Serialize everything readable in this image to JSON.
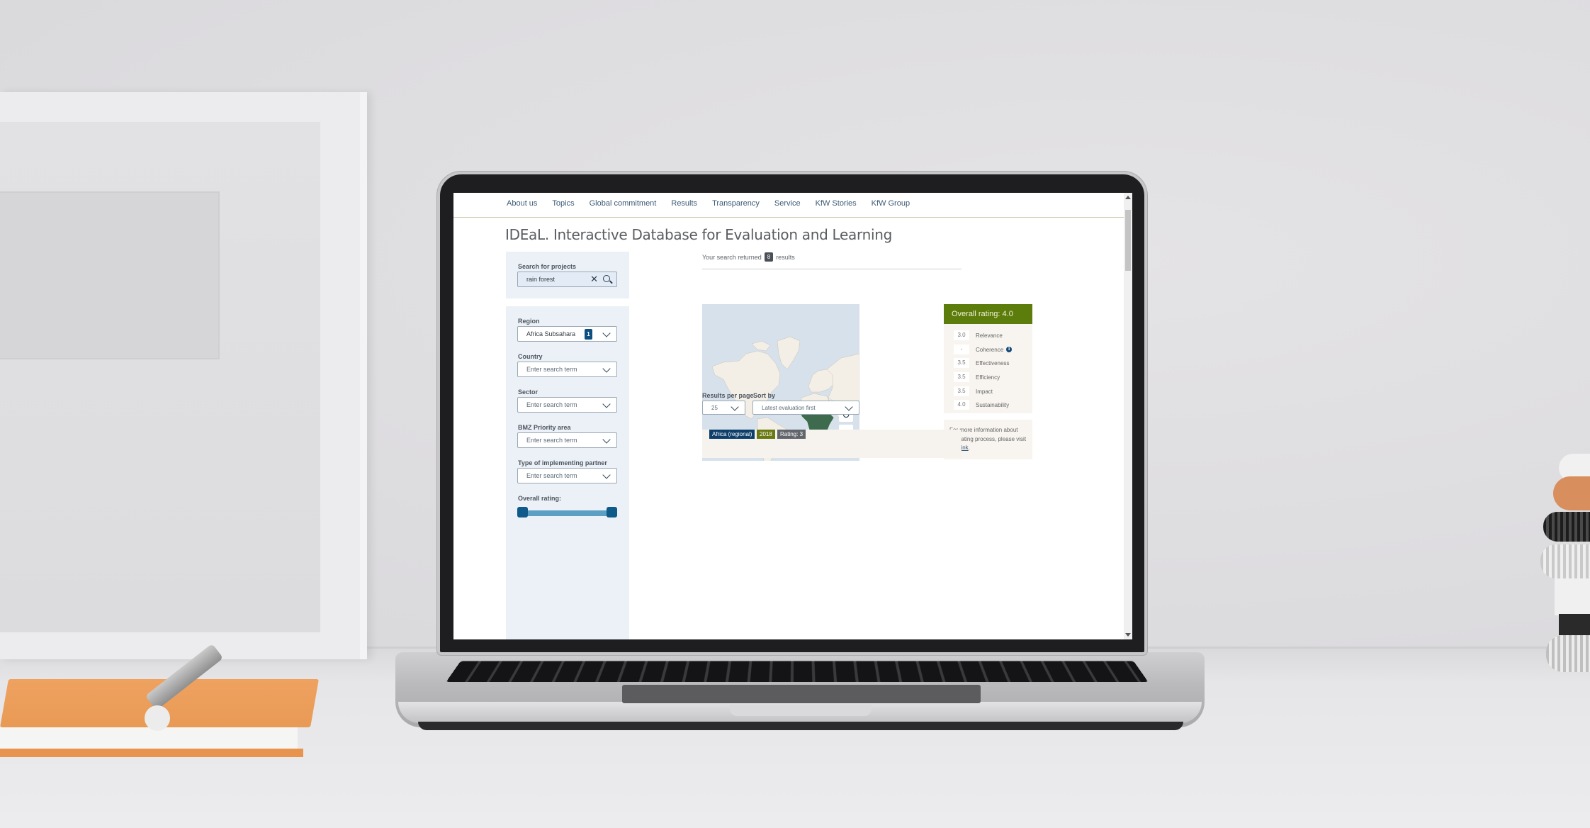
{
  "nav": {
    "items": [
      "About us",
      "Topics",
      "Global commitment",
      "Results",
      "Transparency",
      "Service",
      "KfW Stories",
      "KfW Group"
    ]
  },
  "page": {
    "title": "IDEaL. Interactive Database for Evaluation and Learning"
  },
  "search": {
    "label": "Search for projects",
    "value": "rain forest",
    "clear_icon": "close-icon",
    "search_icon": "search-icon"
  },
  "filters": {
    "region": {
      "label": "Region",
      "value": "Africa Subsahara",
      "selected_count": "1"
    },
    "country": {
      "label": "Country",
      "placeholder": "Enter search term"
    },
    "sector": {
      "label": "Sector",
      "placeholder": "Enter search term"
    },
    "bmz": {
      "label": "BMZ Priority area",
      "placeholder": "Enter search term"
    },
    "partner": {
      "label": "Type of implementing partner",
      "placeholder": "Enter search term"
    },
    "overall_rating": {
      "label": "Overall rating:",
      "range_min_fraction": 0.0,
      "range_max_fraction": 1.0
    }
  },
  "results": {
    "prefix": "Your search returned",
    "count": "8",
    "suffix": "results"
  },
  "map": {
    "highlighted_region": "Sub-Saharan Africa",
    "reset_icon": "refresh-icon",
    "zoom_in_label": "+",
    "zoom_out_label": "−",
    "reset_label": "↻"
  },
  "rating": {
    "title": "Overall rating: 4.0",
    "rows": [
      {
        "value": "3.0",
        "label": "Relevance"
      },
      {
        "value": "-",
        "label": "Coherence",
        "info": true
      },
      {
        "value": "3.5",
        "label": "Effectiveness"
      },
      {
        "value": "3.5",
        "label": "Efficiency"
      },
      {
        "value": "3.5",
        "label": "Impact"
      },
      {
        "value": "4.0",
        "label": "Sustainability"
      }
    ],
    "info_text": "For more information about our rating process, please visit ",
    "info_link": "this link",
    "info_end": ".",
    "info_icon_glyph": "i"
  },
  "controls": {
    "per_page": {
      "label": "Results per page",
      "value": "25"
    },
    "sort": {
      "label": "Sort by",
      "value": "Latest evaluation first"
    }
  },
  "result_card": {
    "tags": [
      {
        "text": "Africa (regional)",
        "color": "#0e3f6a"
      },
      {
        "text": "2018",
        "color": "#6a7a12"
      },
      {
        "text": "Rating: 3",
        "color": "#62666c"
      }
    ]
  },
  "colors": {
    "accent_green": "#5c7c0c",
    "map_highlight": "#3e6b4e",
    "brand_blue": "#0e4f82"
  }
}
